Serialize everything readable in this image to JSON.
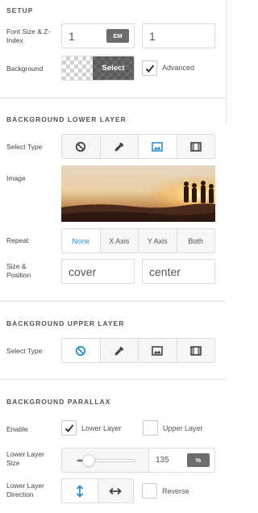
{
  "setup": {
    "title": "SETUP",
    "font_size_label": "Font Size & Z-Index",
    "font_size_value": "1",
    "font_unit": "EM",
    "z_index_value": "1",
    "background_label": "Background",
    "select_label": "Select",
    "advanced_label": "Advanced",
    "advanced_checked": true
  },
  "lower": {
    "title": "BACKGROUND LOWER LAYER",
    "select_type_label": "Select Type",
    "types": [
      "none-icon",
      "color-icon",
      "image-icon",
      "video-icon"
    ],
    "active_type": "image-icon",
    "image_label": "Image",
    "repeat_label": "Repeat",
    "repeat_options": [
      "None",
      "X Axis",
      "Y Axis",
      "Both"
    ],
    "repeat_active": "None",
    "size_position_label": "Size & Position",
    "size_value": "cover",
    "position_value": "center"
  },
  "upper": {
    "title": "BACKGROUND UPPER LAYER",
    "select_type_label": "Select Type",
    "types": [
      "none-icon",
      "color-icon",
      "image-icon",
      "video-icon"
    ],
    "active_type": "none-icon"
  },
  "parallax": {
    "title": "BACKGROUND PARALLAX",
    "enable_label": "Enable",
    "lower_layer_label": "Lower Layer",
    "lower_checked": true,
    "upper_layer_label": "Upper Layer",
    "upper_checked": false,
    "size_label": "Lower Layer Size",
    "size_value": "135",
    "size_unit": "%",
    "slider_fraction": 0.2,
    "direction_label": "Lower Layer Direction",
    "direction_active": "vertical",
    "reverse_label": "Reverse",
    "reverse_checked": false
  }
}
